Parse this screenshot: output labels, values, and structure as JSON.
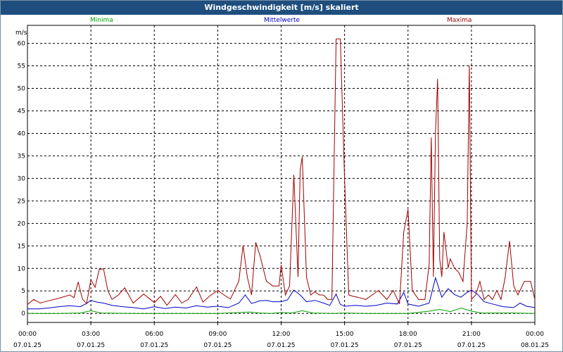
{
  "window": {
    "title": "Windgeschwindigkeit [m/s] skaliert"
  },
  "colors": {
    "min": "#00a000",
    "mean": "#0000c8",
    "max": "#a00000",
    "grid": "#000000",
    "frame": "#000000"
  },
  "chart_data": {
    "type": "line",
    "title": "Windgeschwindigkeit [m/s] skaliert",
    "ylabel": "m/s",
    "ylim": [
      -2,
      64
    ],
    "yticks": [
      0,
      5,
      10,
      15,
      20,
      25,
      30,
      35,
      40,
      45,
      50,
      55,
      60
    ],
    "xlim_hours": [
      0,
      24
    ],
    "xticks": [
      {
        "time": "00:00",
        "date": "07.01.25"
      },
      {
        "time": "03:00",
        "date": "07.01.25"
      },
      {
        "time": "06:00",
        "date": "07.01.25"
      },
      {
        "time": "09:00",
        "date": "07.01.25"
      },
      {
        "time": "12:00",
        "date": "07.01.25"
      },
      {
        "time": "15:00",
        "date": "07.01.25"
      },
      {
        "time": "18:00",
        "date": "07.01.25"
      },
      {
        "time": "21:00",
        "date": "07.01.25"
      },
      {
        "time": "00:00",
        "date": "08.01.25"
      }
    ],
    "grid": true,
    "legend_position": "top",
    "series": [
      {
        "name": "Minima",
        "x_hours": [
          0,
          1.5,
          2.5,
          3,
          3.5,
          5,
          7,
          9,
          10.5,
          11,
          11.5,
          12,
          12.5,
          13,
          13.5,
          14.5,
          15,
          16,
          17,
          18,
          19,
          19.5,
          20,
          20.5,
          21,
          21.5,
          22,
          23,
          24
        ],
        "values": [
          0,
          0,
          0.1,
          0.6,
          0.1,
          0,
          0,
          0,
          0.3,
          0.1,
          0,
          0.2,
          0.1,
          0.6,
          0.1,
          0,
          0.1,
          0,
          0,
          0,
          0.5,
          0.9,
          0.4,
          1.2,
          0.5,
          0.1,
          0.1,
          0.1,
          0
        ]
      },
      {
        "name": "Mittelwerte",
        "x_hours": [
          0,
          0.5,
          1,
          1.5,
          2,
          2.5,
          2.8,
          3,
          3.3,
          3.6,
          4,
          4.5,
          5,
          5.5,
          6,
          6.5,
          7,
          7.5,
          8,
          8.5,
          9,
          9.5,
          10,
          10.3,
          10.6,
          11,
          11.3,
          11.6,
          12,
          12.3,
          12.6,
          12.9,
          13.2,
          13.6,
          14,
          14.3,
          14.6,
          14.8,
          15,
          15.5,
          16,
          16.5,
          17,
          17.5,
          17.8,
          18,
          18.5,
          19,
          19.3,
          19.6,
          19.9,
          20.2,
          20.5,
          20.8,
          21,
          21.3,
          21.6,
          22,
          22.5,
          23,
          23.3,
          23.6,
          24
        ],
        "values": [
          1,
          1,
          1.2,
          1.5,
          1.7,
          1.5,
          2.2,
          2.9,
          2.5,
          2.3,
          1.8,
          1.5,
          1.3,
          1,
          1.5,
          1.1,
          1.4,
          1.2,
          1.7,
          1.4,
          1.6,
          1.3,
          2.3,
          4.1,
          2.2,
          2.8,
          2.9,
          2.6,
          2.6,
          3,
          5.2,
          4.1,
          2.6,
          2.9,
          2.3,
          1.8,
          4.3,
          2,
          1.6,
          1.8,
          1.6,
          1.8,
          2.3,
          2.1,
          4.7,
          2.1,
          1.6,
          2.3,
          7.9,
          3.6,
          5.5,
          4.2,
          3.6,
          4.7,
          5.2,
          4.2,
          2.6,
          2.1,
          1.5,
          1.3,
          2.3,
          1.6,
          1.3
        ]
      },
      {
        "name": "Maxima",
        "x_hours": [
          0,
          0.3,
          0.6,
          1,
          1.5,
          2,
          2.2,
          2.4,
          2.6,
          2.8,
          3,
          3.2,
          3.4,
          3.6,
          3.8,
          4,
          4.3,
          4.6,
          5,
          5.5,
          6,
          6.3,
          6.6,
          7,
          7.3,
          7.6,
          8,
          8.3,
          8.6,
          9,
          9.3,
          9.6,
          10,
          10.2,
          10.4,
          10.6,
          10.8,
          11,
          11.3,
          11.6,
          11.9,
          12,
          12.2,
          12.4,
          12.6,
          12.8,
          12.9,
          13,
          13.2,
          13.4,
          13.6,
          13.8,
          14,
          14.2,
          14.4,
          14.6,
          14.7,
          14.8,
          15,
          15.2,
          15.4,
          15.7,
          16,
          16.3,
          16.6,
          17,
          17.3,
          17.6,
          17.8,
          18,
          18.2,
          18.5,
          18.8,
          19,
          19.1,
          19.2,
          19.3,
          19.4,
          19.5,
          19.6,
          19.7,
          19.9,
          20,
          20.2,
          20.4,
          20.6,
          20.8,
          20.9,
          21,
          21.2,
          21.4,
          21.6,
          21.8,
          22,
          22.2,
          22.4,
          22.6,
          22.8,
          23,
          23.2,
          23.5,
          23.8,
          24
        ],
        "values": [
          2,
          3.1,
          2.3,
          2.8,
          3.4,
          4.1,
          3.5,
          7,
          3.2,
          2.2,
          7.5,
          5.8,
          9.8,
          9.9,
          5.1,
          3.1,
          4.1,
          5.7,
          2.3,
          4.3,
          2.4,
          3.8,
          1.8,
          4.2,
          2.3,
          3.1,
          5.9,
          2.5,
          3.8,
          5.1,
          4.1,
          3.2,
          7.2,
          15.1,
          8.1,
          4.1,
          15.8,
          12.8,
          7.2,
          6.1,
          6.1,
          10.8,
          4.1,
          6.1,
          30.8,
          8.1,
          31.8,
          34.8,
          8.1,
          4.1,
          4.8,
          4.1,
          4.1,
          3.1,
          3.1,
          61,
          61,
          61,
          30,
          4.1,
          3.8,
          3.5,
          3.1,
          4.1,
          5.1,
          3.1,
          5.1,
          2.1,
          18.1,
          23.1,
          5.1,
          3.1,
          3.1,
          10.8,
          39.1,
          8.1,
          40.1,
          52.1,
          12.1,
          8.1,
          18.1,
          10.1,
          12.1,
          10.1,
          9.1,
          7.1,
          20.1,
          55.1,
          3.1,
          4.1,
          7.1,
          3.1,
          4.1,
          3.1,
          5.1,
          3.1,
          8.1,
          16.1,
          6.1,
          4.1,
          7.1,
          7.1,
          3.1,
          4.1,
          2.1
        ]
      }
    ]
  }
}
